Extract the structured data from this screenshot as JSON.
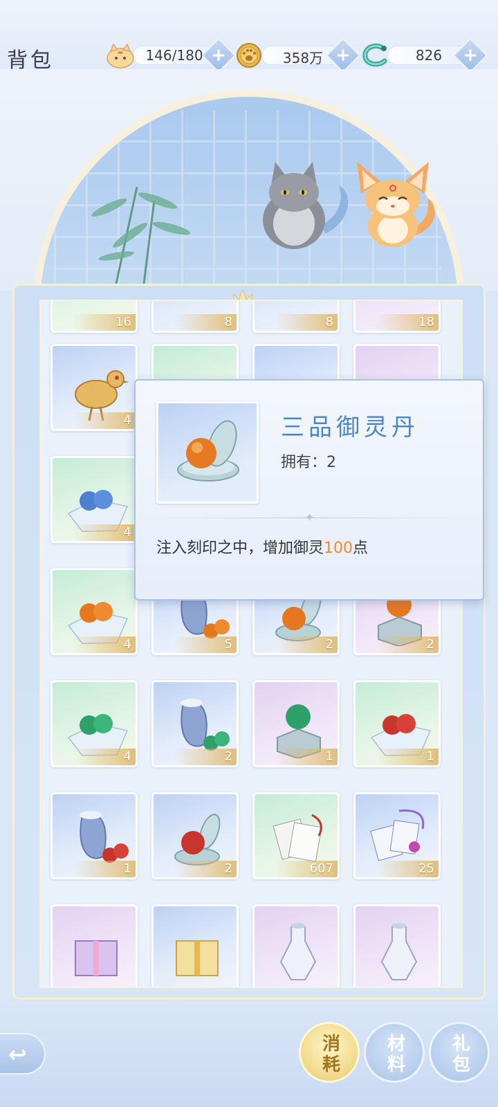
{
  "header": {
    "title": "背包",
    "stamina": "146/180",
    "coins": "358万",
    "gems": "826",
    "plus": "+"
  },
  "inventory": {
    "top_row_counts": [
      "16",
      "8",
      "8",
      "18"
    ],
    "rows": [
      [
        {
          "name": "golden-bird",
          "bg": "blue",
          "count": "4"
        },
        {
          "name": "item",
          "bg": "green",
          "count": ""
        },
        {
          "name": "item",
          "bg": "blue",
          "count": ""
        },
        {
          "name": "item",
          "bg": "purple",
          "count": ""
        }
      ],
      [
        {
          "name": "blue-orbs-cloth",
          "bg": "green",
          "count": "4"
        },
        {
          "name": "item",
          "bg": "blue",
          "count": ""
        },
        {
          "name": "item",
          "bg": "blue",
          "count": ""
        },
        {
          "name": "item",
          "bg": "purple",
          "count": ""
        }
      ],
      [
        {
          "name": "orange-orbs-cloth",
          "bg": "green",
          "count": "4"
        },
        {
          "name": "orange-orbs-pouch",
          "bg": "blue",
          "count": "5"
        },
        {
          "name": "orange-orb-case",
          "bg": "blue",
          "count": "2"
        },
        {
          "name": "orange-orb-box",
          "bg": "purple",
          "count": "2"
        }
      ],
      [
        {
          "name": "green-orbs-cloth",
          "bg": "green",
          "count": "4"
        },
        {
          "name": "green-orbs-pouch",
          "bg": "blue",
          "count": "2"
        },
        {
          "name": "green-orb-box",
          "bg": "purple",
          "count": "1"
        },
        {
          "name": "red-orbs-cloth",
          "bg": "green",
          "count": "1"
        }
      ],
      [
        {
          "name": "red-orbs-pouch",
          "bg": "blue",
          "count": "1"
        },
        {
          "name": "red-orb-case",
          "bg": "blue",
          "count": "2"
        },
        {
          "name": "scroll-papers",
          "bg": "green",
          "count": "607"
        },
        {
          "name": "talisman-scrolls",
          "bg": "blue",
          "count": "25"
        }
      ],
      [
        {
          "name": "purple-gift-box",
          "bg": "purple",
          "count": ""
        },
        {
          "name": "gold-gift-box",
          "bg": "blue",
          "count": ""
        },
        {
          "name": "potion-bottle",
          "bg": "purple",
          "count": ""
        },
        {
          "name": "potion-bottle",
          "bg": "purple",
          "count": ""
        }
      ]
    ]
  },
  "tooltip": {
    "name": "三品御灵丹",
    "own_label": "拥有：",
    "own_value": "2",
    "desc_prefix": "注入刻印之中，增加御灵",
    "desc_value": "100",
    "desc_suffix": "点"
  },
  "tabs": [
    {
      "label": "消耗",
      "active": true
    },
    {
      "label": "材料",
      "active": false
    },
    {
      "label": "礼包",
      "active": false
    }
  ],
  "colors": {
    "accent": "#4a86c9",
    "highlight": "#f08a2a",
    "count_badge": "#e0b462"
  },
  "icons": [
    "cat-stamina-icon",
    "paw-coin-icon",
    "dragon-gem-icon",
    "back-arrow-icon"
  ]
}
